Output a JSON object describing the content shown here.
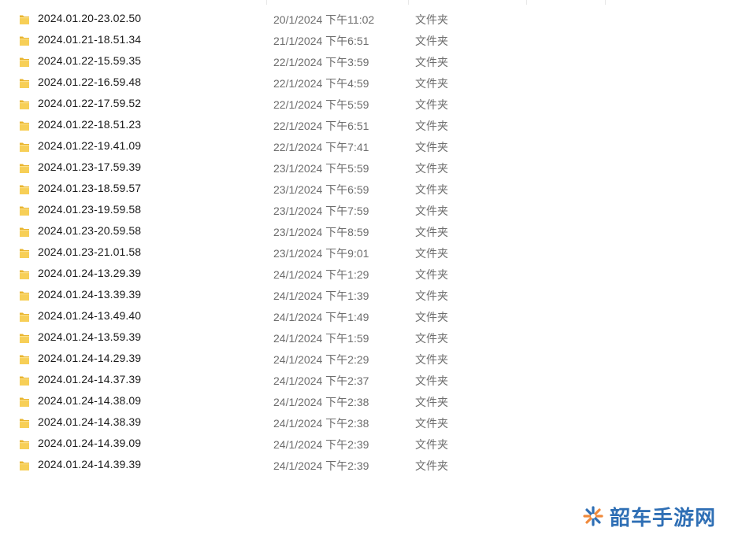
{
  "files": [
    {
      "name": "2024.01.20-23.02.50",
      "date": "20/1/2024 下午11:02",
      "type": "文件夹"
    },
    {
      "name": "2024.01.21-18.51.34",
      "date": "21/1/2024 下午6:51",
      "type": "文件夹"
    },
    {
      "name": "2024.01.22-15.59.35",
      "date": "22/1/2024 下午3:59",
      "type": "文件夹"
    },
    {
      "name": "2024.01.22-16.59.48",
      "date": "22/1/2024 下午4:59",
      "type": "文件夹"
    },
    {
      "name": "2024.01.22-17.59.52",
      "date": "22/1/2024 下午5:59",
      "type": "文件夹"
    },
    {
      "name": "2024.01.22-18.51.23",
      "date": "22/1/2024 下午6:51",
      "type": "文件夹"
    },
    {
      "name": "2024.01.22-19.41.09",
      "date": "22/1/2024 下午7:41",
      "type": "文件夹"
    },
    {
      "name": "2024.01.23-17.59.39",
      "date": "23/1/2024 下午5:59",
      "type": "文件夹"
    },
    {
      "name": "2024.01.23-18.59.57",
      "date": "23/1/2024 下午6:59",
      "type": "文件夹"
    },
    {
      "name": "2024.01.23-19.59.58",
      "date": "23/1/2024 下午7:59",
      "type": "文件夹"
    },
    {
      "name": "2024.01.23-20.59.58",
      "date": "23/1/2024 下午8:59",
      "type": "文件夹"
    },
    {
      "name": "2024.01.23-21.01.58",
      "date": "23/1/2024 下午9:01",
      "type": "文件夹"
    },
    {
      "name": "2024.01.24-13.29.39",
      "date": "24/1/2024 下午1:29",
      "type": "文件夹"
    },
    {
      "name": "2024.01.24-13.39.39",
      "date": "24/1/2024 下午1:39",
      "type": "文件夹"
    },
    {
      "name": "2024.01.24-13.49.40",
      "date": "24/1/2024 下午1:49",
      "type": "文件夹"
    },
    {
      "name": "2024.01.24-13.59.39",
      "date": "24/1/2024 下午1:59",
      "type": "文件夹"
    },
    {
      "name": "2024.01.24-14.29.39",
      "date": "24/1/2024 下午2:29",
      "type": "文件夹"
    },
    {
      "name": "2024.01.24-14.37.39",
      "date": "24/1/2024 下午2:37",
      "type": "文件夹"
    },
    {
      "name": "2024.01.24-14.38.09",
      "date": "24/1/2024 下午2:38",
      "type": "文件夹"
    },
    {
      "name": "2024.01.24-14.38.39",
      "date": "24/1/2024 下午2:38",
      "type": "文件夹"
    },
    {
      "name": "2024.01.24-14.39.09",
      "date": "24/1/2024 下午2:39",
      "type": "文件夹"
    },
    {
      "name": "2024.01.24-14.39.39",
      "date": "24/1/2024 下午2:39",
      "type": "文件夹"
    }
  ],
  "icons": {
    "row_icon": "folder-icon",
    "watermark_logo": "snowflake-logo-icon"
  },
  "colors": {
    "folder": "#f5c84c",
    "name_text": "#1a1a1a",
    "meta_text": "#6d6d6d",
    "watermark": "#2f6fb5",
    "watermark_logo_orange": "#f08a3c"
  },
  "watermark": {
    "text": "韶车手游网"
  }
}
